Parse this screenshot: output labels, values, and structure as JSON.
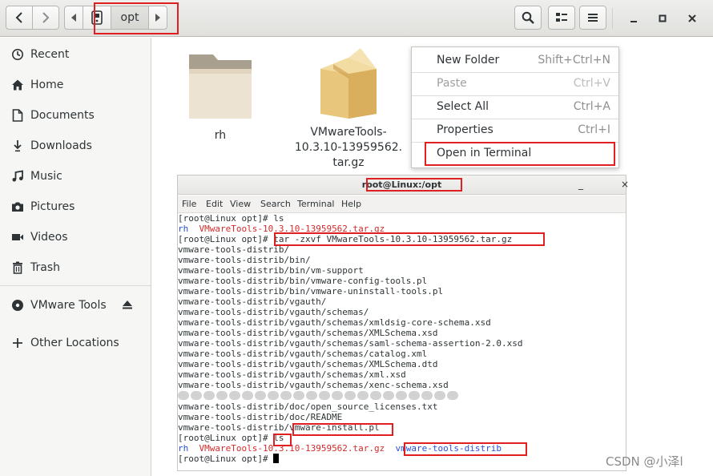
{
  "header": {
    "path_current": "opt",
    "icons": {
      "back": "chevron-left-icon",
      "forward": "chevron-right-icon",
      "search": "search-icon",
      "view": "grid-view-icon",
      "menu": "hamburger-menu-icon"
    }
  },
  "sidebar": {
    "items": [
      {
        "label": "Recent",
        "icon": "clock-icon"
      },
      {
        "label": "Home",
        "icon": "home-icon"
      },
      {
        "label": "Documents",
        "icon": "document-icon"
      },
      {
        "label": "Downloads",
        "icon": "download-icon"
      },
      {
        "label": "Music",
        "icon": "music-icon"
      },
      {
        "label": "Pictures",
        "icon": "camera-icon"
      },
      {
        "label": "Videos",
        "icon": "video-icon"
      },
      {
        "label": "Trash",
        "icon": "trash-icon"
      },
      {
        "label": "VMware Tools",
        "icon": "disc-icon"
      },
      {
        "label": "Other Locations",
        "icon": "plus-icon"
      }
    ]
  },
  "files": [
    {
      "name": "rh",
      "icon": "folder-icon"
    },
    {
      "name_lines": [
        "VMwareTools-",
        "10.3.10-13959562.",
        "tar.gz"
      ],
      "icon": "archive-icon"
    }
  ],
  "context_menu": {
    "items": [
      {
        "label": "New Folder",
        "accel": "Shift+Ctrl+N",
        "enabled": true
      },
      {
        "label": "Paste",
        "accel": "Ctrl+V",
        "enabled": false
      },
      {
        "label": "Select All",
        "accel": "Ctrl+A",
        "enabled": true
      },
      {
        "label": "Properties",
        "accel": "Ctrl+I",
        "enabled": true
      },
      {
        "label": "Open in Terminal",
        "accel": "",
        "enabled": true
      }
    ]
  },
  "terminal": {
    "title": "root@Linux:/opt",
    "controls": {
      "minimize": "_",
      "close": "×"
    },
    "menu": [
      "File",
      "Edit",
      "View",
      "Search",
      "Terminal",
      "Help"
    ],
    "prompt": "[root@Linux opt]# ",
    "cmd_ls": "ls",
    "cmd_tar": "tar -zxvf VMwareTools-10.3.10-13959562.tar.gz",
    "ls_dir": "rh",
    "ls_tar": "VMwareTools-10.3.10-13959562.tar.gz",
    "ls_extracted": "vmware-tools-distrib",
    "output": [
      "vmware-tools-distrib/",
      "vmware-tools-distrib/bin/",
      "vmware-tools-distrib/bin/vm-support",
      "vmware-tools-distrib/bin/vmware-config-tools.pl",
      "vmware-tools-distrib/bin/vmware-uninstall-tools.pl",
      "vmware-tools-distrib/vgauth/",
      "vmware-tools-distrib/vgauth/schemas/",
      "vmware-tools-distrib/vgauth/schemas/xmldsig-core-schema.xsd",
      "vmware-tools-distrib/vgauth/schemas/XMLSchema.xsd",
      "vmware-tools-distrib/vgauth/schemas/saml-schema-assertion-2.0.xsd",
      "vmware-tools-distrib/vgauth/schemas/catalog.xml",
      "vmware-tools-distrib/vgauth/schemas/XMLSchema.dtd",
      "vmware-tools-distrib/vgauth/schemas/xml.xsd",
      "vmware-tools-distrib/vgauth/schemas/xenc-schema.xsd"
    ],
    "output_after": [
      "vmware-tools-distrib/doc/open_source_licenses.txt",
      "vmware-tools-distrib/doc/README"
    ],
    "install_prefix": "vmware-tools-distrib/",
    "install_file": "vmware-install.pl"
  },
  "watermark": "CSDN @小泽l",
  "colors": {
    "highlight_box": "#e02020",
    "terminal_blue": "#2850d8",
    "terminal_red": "#d42b2b"
  }
}
